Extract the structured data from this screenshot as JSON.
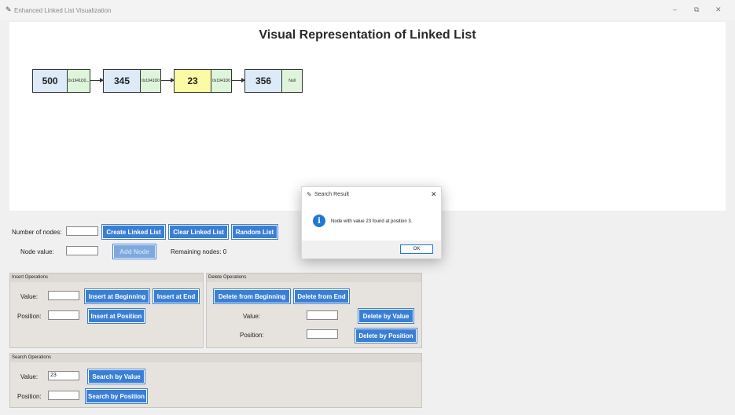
{
  "window": {
    "title": "Enhanced Linked List Visualization",
    "minimize_glyph": "–",
    "maximize_glyph": "⧉",
    "close_glyph": "✕",
    "icon": "feather-icon"
  },
  "canvas": {
    "title": "Visual Representation of Linked List",
    "nodes": [
      {
        "value": "500",
        "pointer": "0x1941D0...",
        "highlight": false
      },
      {
        "value": "345",
        "pointer": "0x1941D0",
        "highlight": false
      },
      {
        "value": "23",
        "pointer": "0x1941D0",
        "highlight": true
      },
      {
        "value": "356",
        "pointer": "Null",
        "highlight": false
      }
    ]
  },
  "create": {
    "num_nodes_label": "Number of nodes:",
    "num_nodes_value": "",
    "create_button": "Create Linked List",
    "clear_button": "Clear Linked List",
    "random_button": "Random List",
    "node_value_label": "Node value:",
    "node_value": "",
    "add_node_button": "Add Node",
    "remaining_label": "Remaining nodes: 0"
  },
  "insert": {
    "header": "Insert Operations",
    "value_label": "Value:",
    "position_label": "Position:",
    "value": "",
    "position": "",
    "at_beginning_button": "Insert at Beginning",
    "at_end_button": "Insert at End",
    "at_position_button": "Insert at Position"
  },
  "delete": {
    "header": "Delete Operations",
    "from_beginning_button": "Delete from Beginning",
    "from_end_button": "Delete from End",
    "value_label": "Value:",
    "position_label": "Position:",
    "value": "",
    "position": "",
    "by_value_button": "Delete by Value",
    "by_position_button": "Delete by Position"
  },
  "search": {
    "header": "Search Operations",
    "value_label": "Value:",
    "position_label": "Position:",
    "value": "23",
    "position": "",
    "by_value_button": "Search by Value",
    "by_position_button": "Search by Position"
  },
  "dialog": {
    "title": "Search Result",
    "close_glyph": "✕",
    "info_glyph": "i",
    "message": "Node with value 23 found at position 3.",
    "ok_button": "OK"
  },
  "colors": {
    "button": "#3b7fd4",
    "node_value_bg": "#ddeaf8",
    "node_highlight_bg": "#fdfaa6",
    "node_pointer_bg": "#dff5db",
    "info_icon": "#1f78d4"
  }
}
